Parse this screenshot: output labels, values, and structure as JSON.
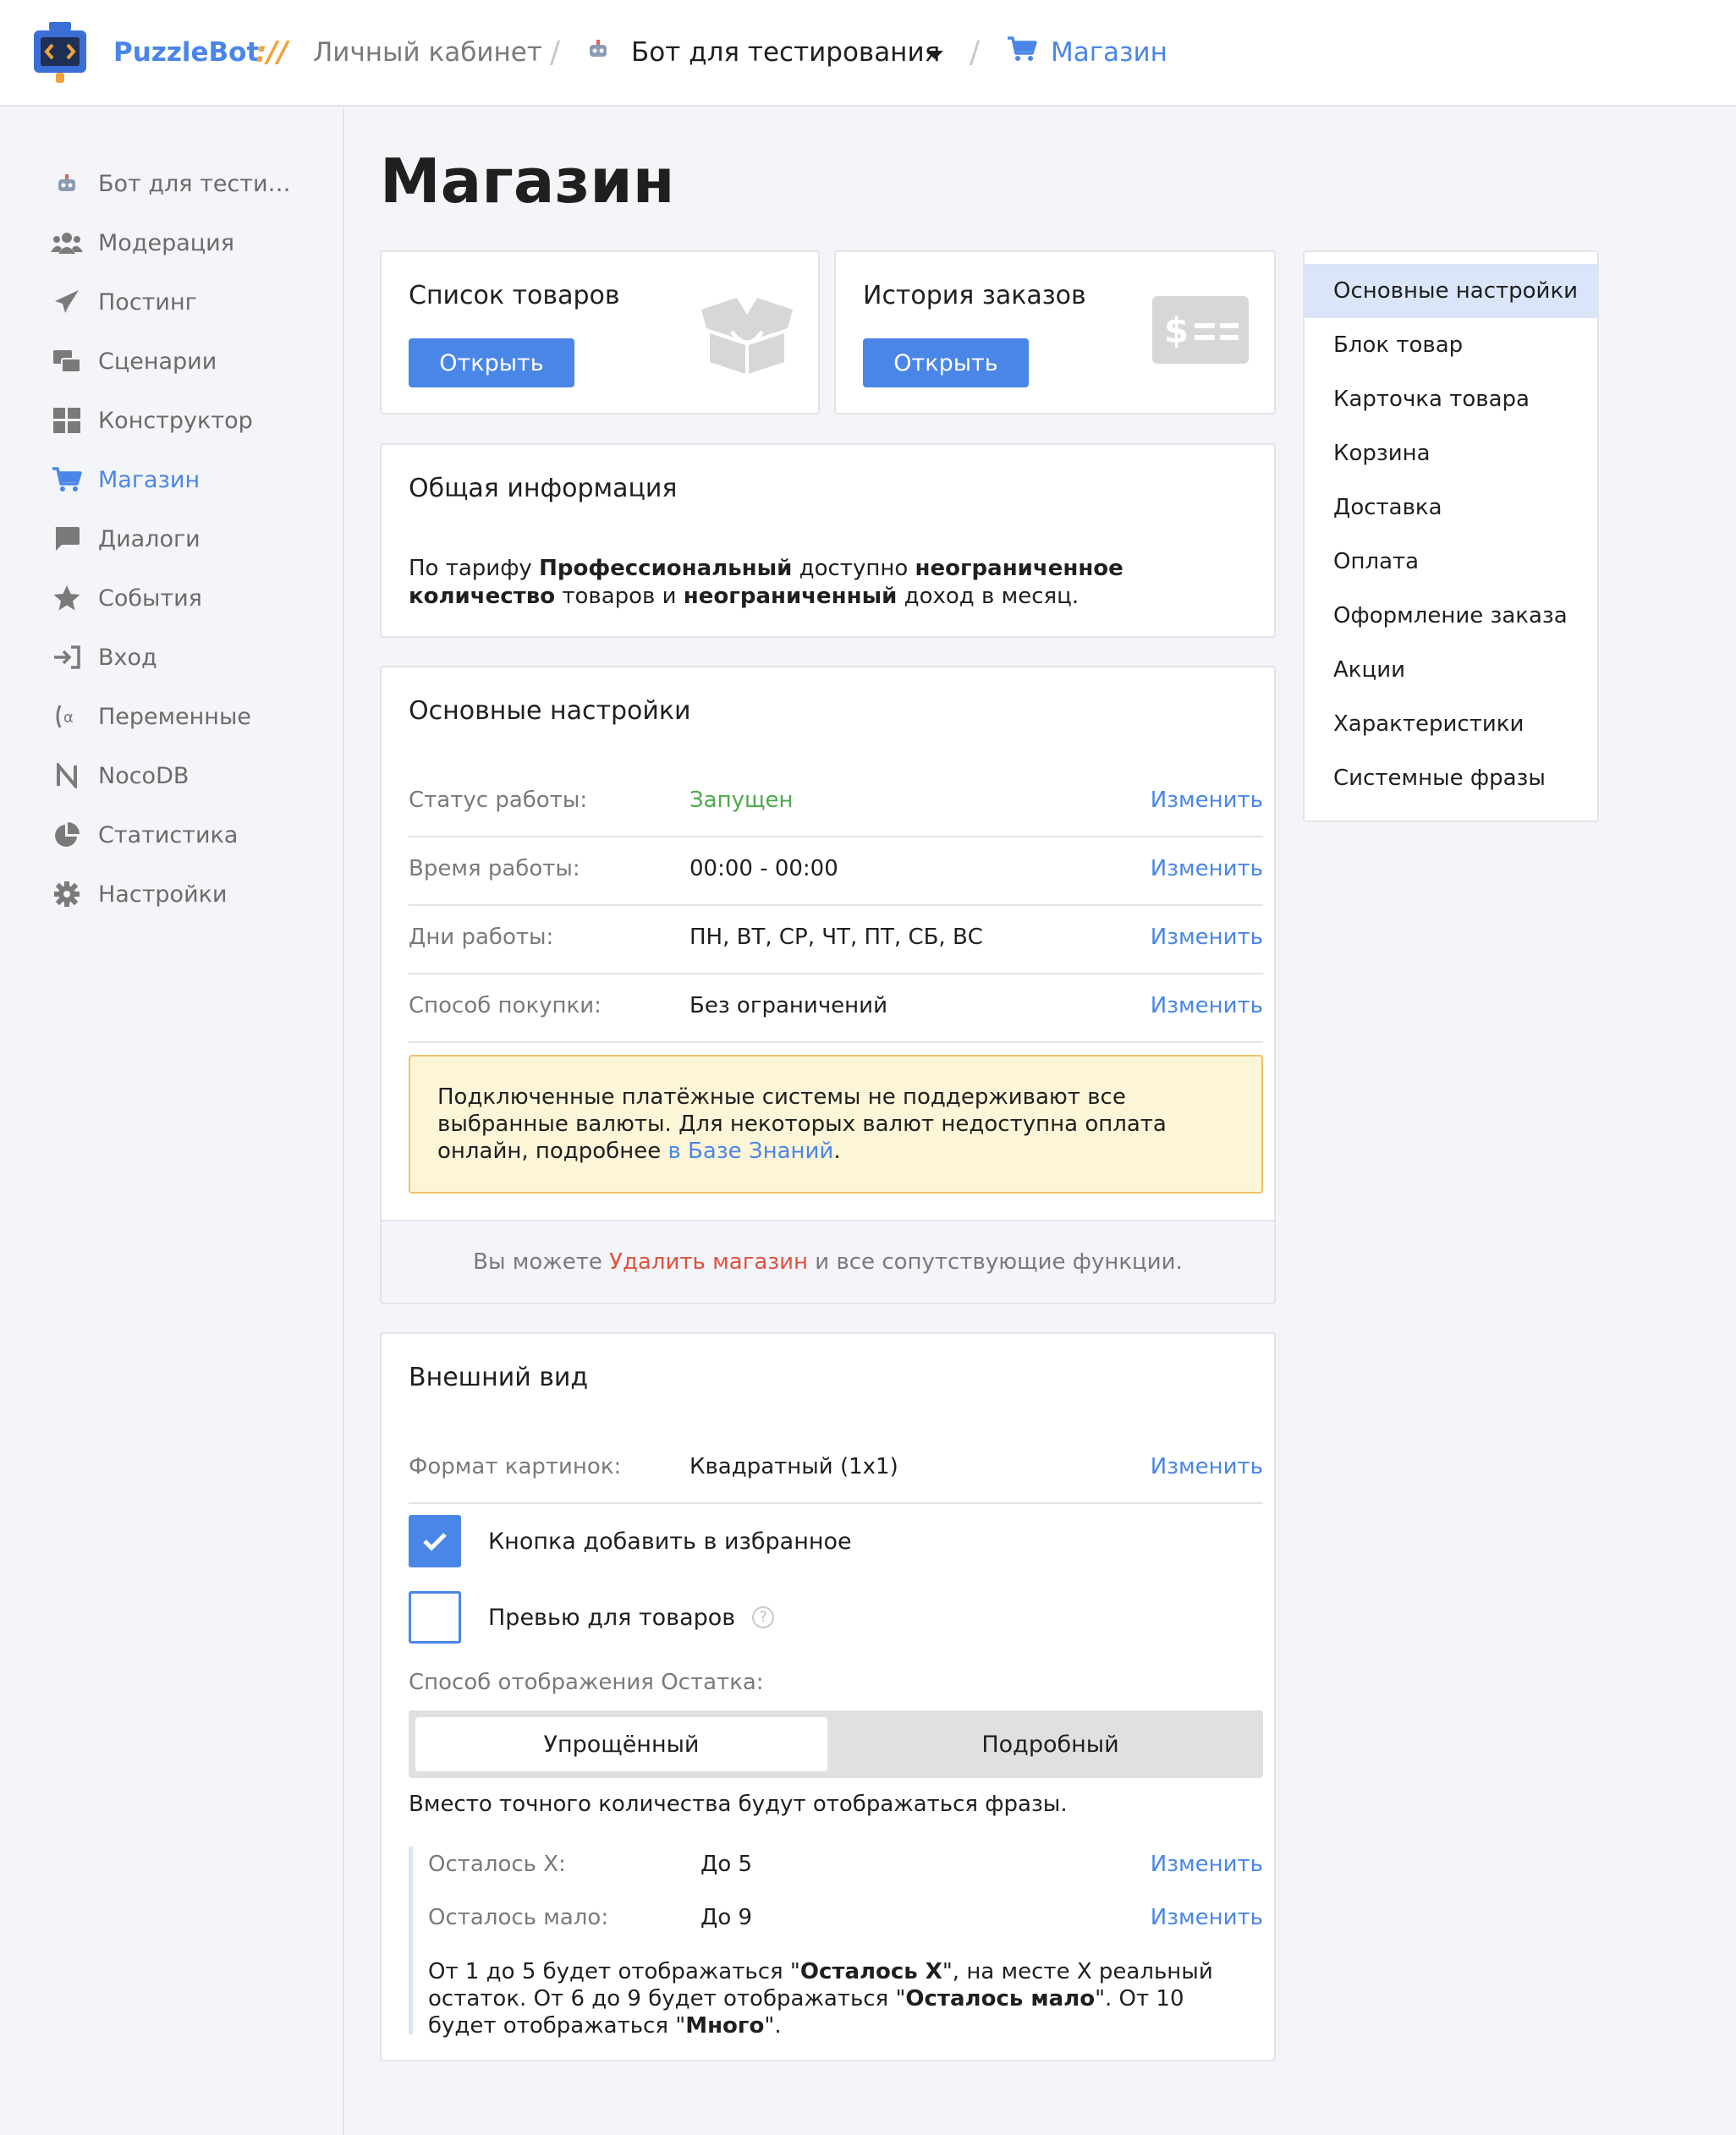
{
  "header": {
    "brand": "PuzzleBot",
    "brand_sep": "://",
    "crumb_cabinet": "Личный кабинет",
    "crumb_bot": "Бот для тестирования",
    "crumb_shop": "Магазин"
  },
  "sidebar": {
    "items": [
      {
        "label": "Бот для тести…",
        "icon": "robot-icon"
      },
      {
        "label": "Модерация",
        "icon": "users-icon"
      },
      {
        "label": "Постинг",
        "icon": "paper-plane-icon"
      },
      {
        "label": "Сценарии",
        "icon": "scenarios-icon"
      },
      {
        "label": "Конструктор",
        "icon": "grid-icon"
      },
      {
        "label": "Магазин",
        "icon": "cart-icon"
      },
      {
        "label": "Диалоги",
        "icon": "chat-icon"
      },
      {
        "label": "События",
        "icon": "star-icon"
      },
      {
        "label": "Вход",
        "icon": "sign-in-icon"
      },
      {
        "label": "Переменные",
        "icon": "variable-icon"
      },
      {
        "label": "NocoDB",
        "icon": "nocodb-icon"
      },
      {
        "label": "Статистика",
        "icon": "pie-chart-icon"
      },
      {
        "label": "Настройки",
        "icon": "gear-icon"
      }
    ],
    "active_index": 5
  },
  "page_title": "Магазин",
  "cards": {
    "products": {
      "title": "Список товаров",
      "button": "Открыть",
      "icon": "box-icon"
    },
    "orders": {
      "title": "История заказов",
      "button": "Открыть",
      "icon": "money-icon"
    }
  },
  "general_info": {
    "title": "Общая информация",
    "t1": "По тарифу ",
    "b1": "Профессиональный",
    "t2": " доступно ",
    "b2": "неограниченное количество",
    "t3": " товаров и ",
    "b3": "неограниченный",
    "t4": " доход в месяц."
  },
  "main_settings": {
    "title": "Основные настройки",
    "rows": [
      {
        "label": "Статус работы:",
        "value": "Запущен",
        "action": "Изменить"
      },
      {
        "label": "Время работы:",
        "value": "00:00 - 00:00",
        "action": "Изменить"
      },
      {
        "label": "Дни работы:",
        "value": "ПН, ВТ, СР, ЧТ, ПТ, СБ, ВС",
        "action": "Изменить"
      },
      {
        "label": "Способ покупки:",
        "value": "Без ограничений",
        "action": "Изменить"
      }
    ],
    "warning_text": "Подключенные платёжные системы не поддерживают все выбранные валюты. Для некоторых валют недоступна оплата онлайн, подробнее ",
    "warning_link": "в Базе Знаний",
    "warning_end": ".",
    "footer_pre": "Вы можете ",
    "footer_link": "Удалить магазин",
    "footer_post": " и все сопутствующие функции.",
    "status_color": "#4caa4c"
  },
  "appearance": {
    "title": "Внешний вид",
    "format_label": "Формат картинок:",
    "format_value": "Квадратный (1x1)",
    "format_action": "Изменить",
    "fav_label": "Кнопка добавить в избранное",
    "fav_checked": true,
    "preview_label": "Превью для товаров",
    "preview_checked": false,
    "help_glyph": "?",
    "stock_label": "Способ отображения Остатка:",
    "seg_simple": "Упрощённый",
    "seg_detailed": "Подробный",
    "phrases_note": "Вместо точного количества будут отображаться фразы.",
    "q1_label": "Осталось Х:",
    "q1_value": "До 5",
    "q1_action": "Изменить",
    "q2_label": "Осталось мало:",
    "q2_value": "До 9",
    "q2_action": "Изменить",
    "qt1": "От 1 до 5 будет отображаться \"",
    "qb1": "Осталось Х",
    "qt2": "\", на месте Х реальный остаток. От 6 до 9 будет отображаться \"",
    "qb2": "Осталось мало",
    "qt3": "\". От 10 будет отображаться \"",
    "qb3": "Много",
    "qt4": "\"."
  },
  "right_menu": {
    "items": [
      "Основные настройки",
      "Блок товар",
      "Карточка товара",
      "Корзина",
      "Доставка",
      "Оплата",
      "Оформление заказа",
      "Акции",
      "Характеристики",
      "Системные фразы"
    ],
    "selected_index": 0
  },
  "colors": {
    "accent": "#4a86e8",
    "danger": "#e0523c",
    "brand_sep": "#f0a33a"
  }
}
